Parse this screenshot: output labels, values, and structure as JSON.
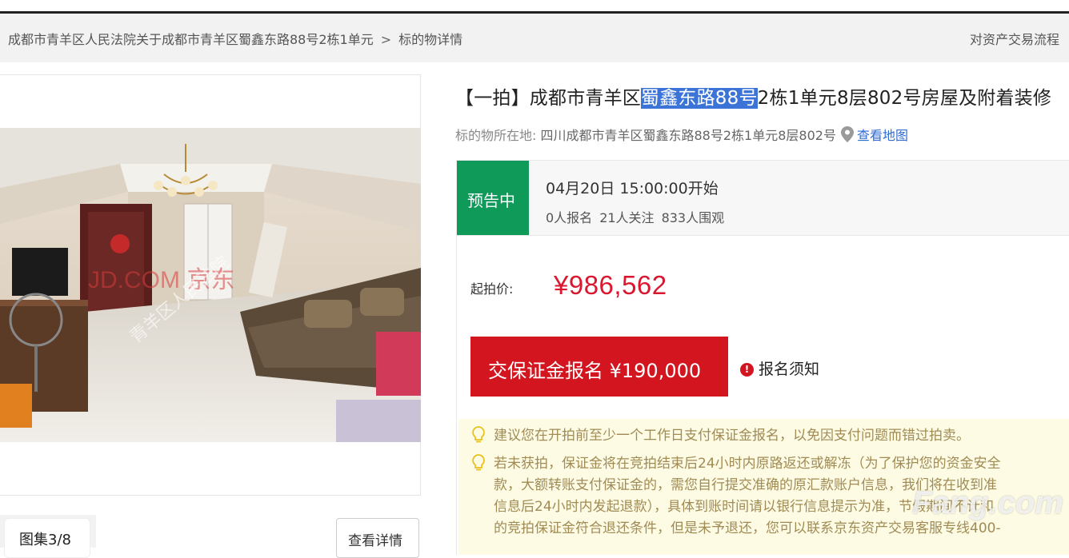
{
  "breadcrumb": {
    "parent": "成都市青羊区人民法院关于成都市青羊区蜀鑫东路88号2栋1单元",
    "separator": ">",
    "current": "标的物详情"
  },
  "header_link": "对资产交易流程",
  "gallery": {
    "counter": "图集3/8",
    "detail_button": "查看详情",
    "photo_watermark": "JD.COM 京东",
    "photo_watermark2": "青羊区人民法院"
  },
  "title": {
    "prefix": "【一拍】成都市青羊区",
    "highlight": "蜀鑫东路88号",
    "suffix": "2栋1单元8层802号房屋及附着装修"
  },
  "location": {
    "label": "标的物所在地:",
    "address": "四川成都市青羊区蜀鑫东路88号2栋1单元8层802号",
    "map_link": "查看地图",
    "icon": "map-pin-icon"
  },
  "status": {
    "badge": "预告中",
    "start_time": "04月20日 15:00:00开始",
    "signups": "0人报名",
    "followers": "21人关注",
    "watchers": "833人围观"
  },
  "price": {
    "label": "起拍价:",
    "value": "¥986,562"
  },
  "deposit_button": "交保证金报名 ¥190,000",
  "notice": {
    "icon": "exclamation-icon",
    "label": "报名须知"
  },
  "tips": [
    "建议您在开拍前至少一个工作日支付保证金报名，以免因支付问题而错过拍卖。",
    "若未获拍，保证金将在竞拍结束后24小时内原路返还或解冻（为了保护您的资金安全",
    "款，大额转账支付保证金的，需您自行提交准确的原汇款账户信息，我们将在收到准",
    "信息后24小时内发起退款），具体到账时间请以银行信息提示为准，节假期间不计和",
    "的竞拍保证金符合退还条件，但是未予退还，您可以联系京东资产交易客服专线400-"
  ],
  "page_watermark": "Fang.com",
  "colors": {
    "status_green": "#0f9a5a",
    "price_red": "#d9172f",
    "button_red": "#d3151f",
    "link_blue": "#2f6bd1",
    "tip_bg": "#fdfbe4"
  }
}
